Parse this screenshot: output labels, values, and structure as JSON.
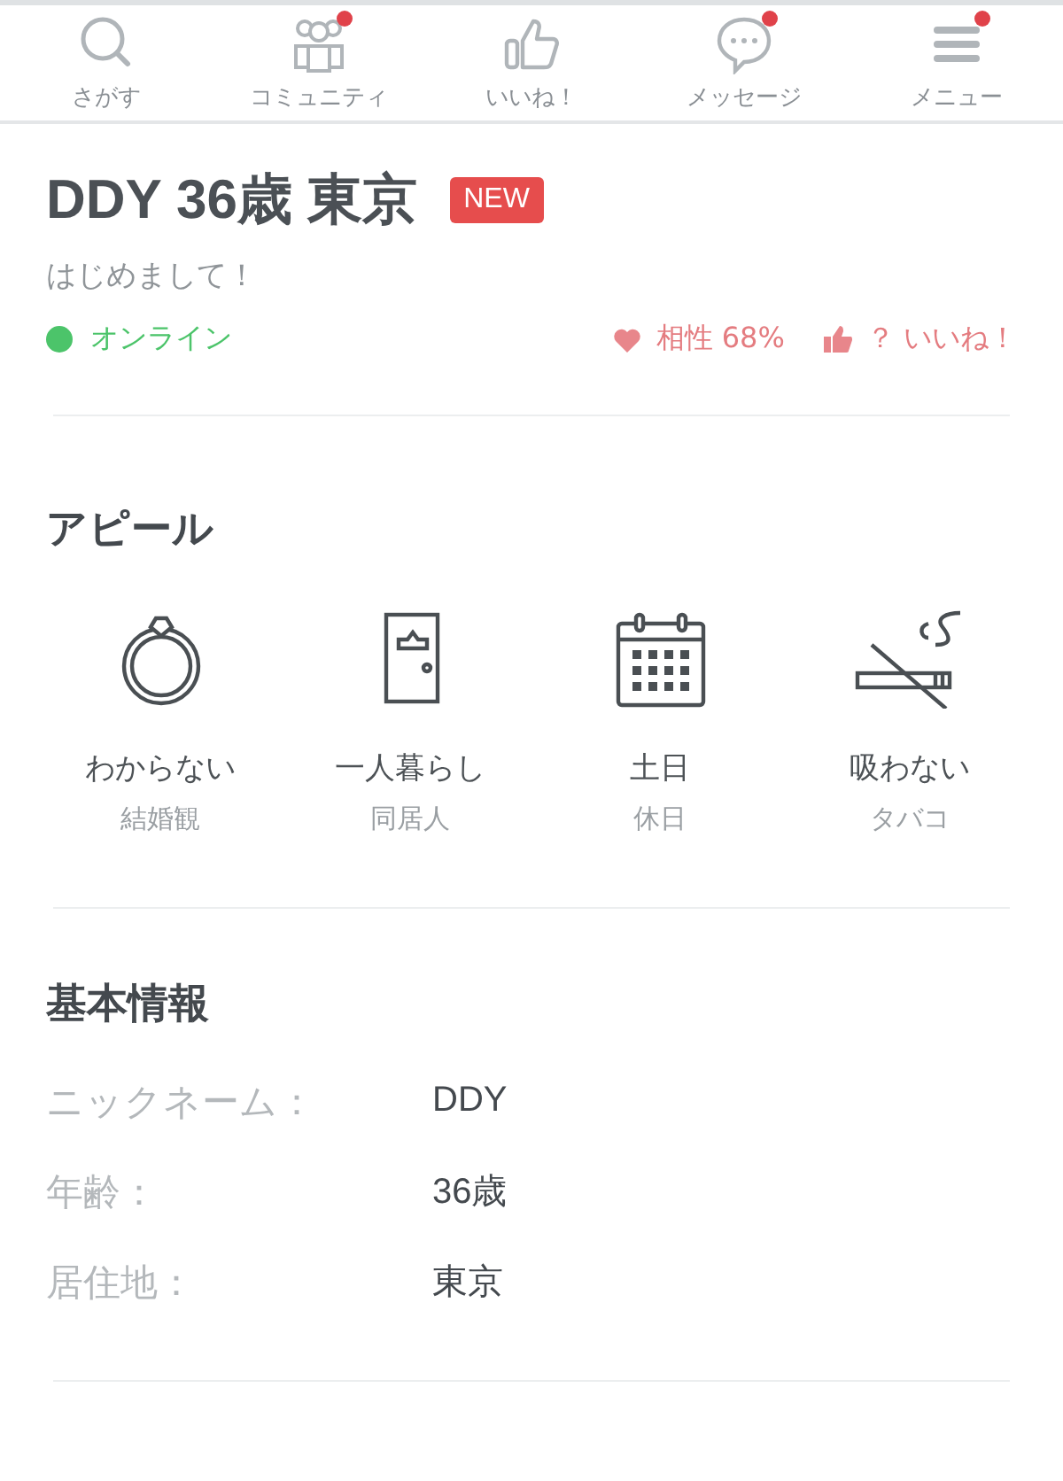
{
  "nav": [
    {
      "label": "さがす",
      "badge": false
    },
    {
      "label": "コミュニティ",
      "badge": true
    },
    {
      "label": "いいね！",
      "badge": false
    },
    {
      "label": "メッセージ",
      "badge": true
    },
    {
      "label": "メニュー",
      "badge": true
    }
  ],
  "profile": {
    "name": "DDY 36歳 東京",
    "badge": "NEW",
    "greeting": "はじめまして！",
    "status": "オンライン",
    "online": true,
    "compatibility": "相性 68%",
    "likes": "？ いいね！"
  },
  "appeal": {
    "title": "アピール",
    "items": [
      {
        "value": "わからない",
        "category": "結婚観"
      },
      {
        "value": "一人暮らし",
        "category": "同居人"
      },
      {
        "value": "土日",
        "category": "休日"
      },
      {
        "value": "吸わない",
        "category": "タバコ"
      }
    ]
  },
  "basic_info": {
    "title": "基本情報",
    "rows": [
      {
        "label": "ニックネーム：",
        "value": "DDY"
      },
      {
        "label": "年齢：",
        "value": "36歳"
      },
      {
        "label": "居住地：",
        "value": "東京"
      }
    ]
  }
}
